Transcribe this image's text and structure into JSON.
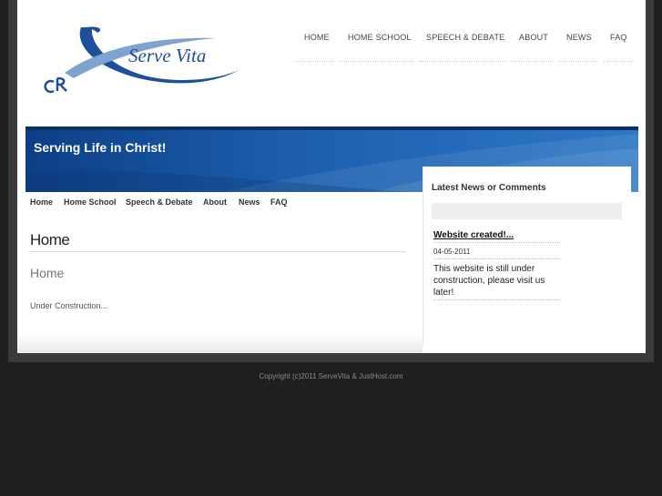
{
  "brand": {
    "name": "Serve Vita"
  },
  "top_nav": [
    {
      "label": "HOME"
    },
    {
      "label": "HOME SCHOOL"
    },
    {
      "label": "SPEECH & DEBATE"
    },
    {
      "label": "ABOUT"
    },
    {
      "label": "NEWS"
    },
    {
      "label": "FAQ"
    }
  ],
  "banner": {
    "title": "Serving Life in Christ!"
  },
  "sub_nav": [
    {
      "label": "Home"
    },
    {
      "label": "Home School"
    },
    {
      "label": "Speech & Debate"
    },
    {
      "label": "About"
    },
    {
      "label": "News"
    },
    {
      "label": "FAQ"
    }
  ],
  "main": {
    "title": "Home",
    "subtitle": "Home",
    "body": "Under Construction..."
  },
  "sidebar": {
    "title": "Latest News or Comments",
    "news": {
      "title": "Website created!...",
      "date": "04-05-2011",
      "text": "This website is still under construction, please visit us later!"
    }
  },
  "footer": {
    "copyright": "Copyright (c)2011 ServeVita & JustHost.com"
  },
  "colors": {
    "banner": "#1d5fae",
    "logo_blue": "#1e4f9a",
    "logo_light": "#7fa3cf"
  }
}
